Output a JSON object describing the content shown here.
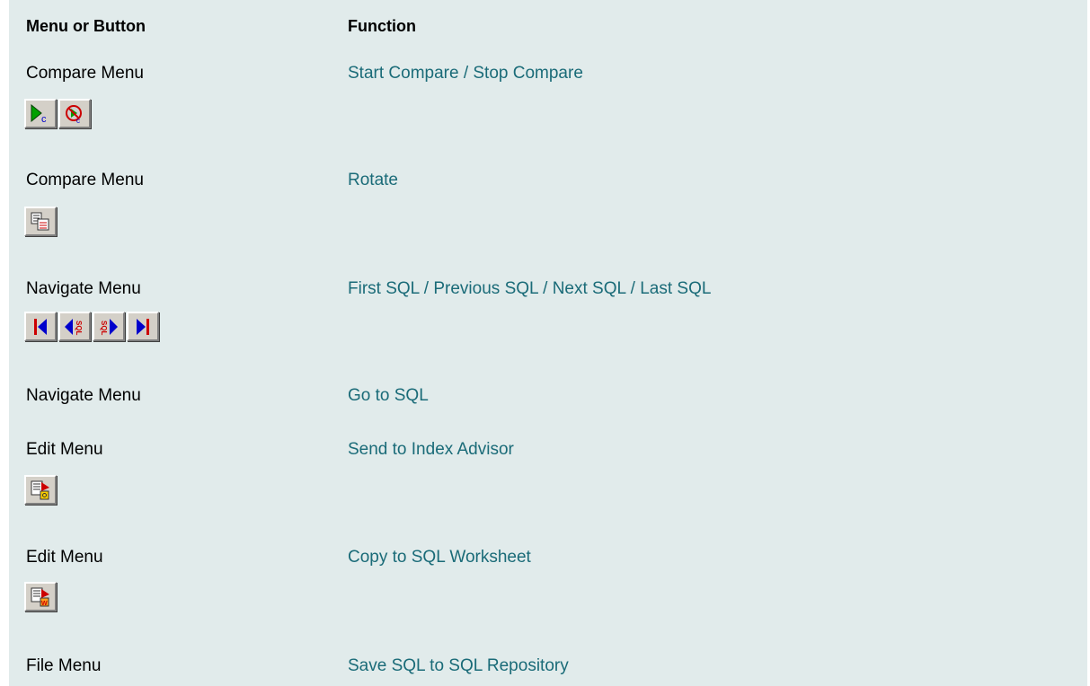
{
  "header": {
    "col1": "Menu or Button",
    "col2": "Function"
  },
  "rows": [
    {
      "menu": "Compare Menu",
      "function": "Start Compare / Stop Compare",
      "icons": [
        "start-compare-icon",
        "stop-compare-icon"
      ]
    },
    {
      "menu": "Compare Menu",
      "function": "Rotate",
      "icons": [
        "rotate-icon"
      ]
    },
    {
      "menu": "Navigate Menu",
      "function": "First SQL / Previous SQL / Next SQL / Last SQL",
      "icons": [
        "first-sql-icon",
        "previous-sql-icon",
        "next-sql-icon",
        "last-sql-icon"
      ]
    },
    {
      "menu": "Navigate Menu",
      "function": "Go to SQL",
      "icons": []
    },
    {
      "menu": "Edit Menu",
      "function": "Send to Index Advisor",
      "icons": [
        "send-to-index-advisor-icon"
      ]
    },
    {
      "menu": "Edit Menu",
      "function": "Copy to SQL Worksheet",
      "icons": [
        "copy-to-sql-worksheet-icon"
      ]
    },
    {
      "menu": "File Menu",
      "function": "Save SQL to SQL Repository",
      "icons": []
    }
  ],
  "colors": {
    "panel_bg": "#e1ebeb",
    "link": "#1a6b78",
    "nav_blue": "#0000cc",
    "nav_red": "#cc0000"
  }
}
